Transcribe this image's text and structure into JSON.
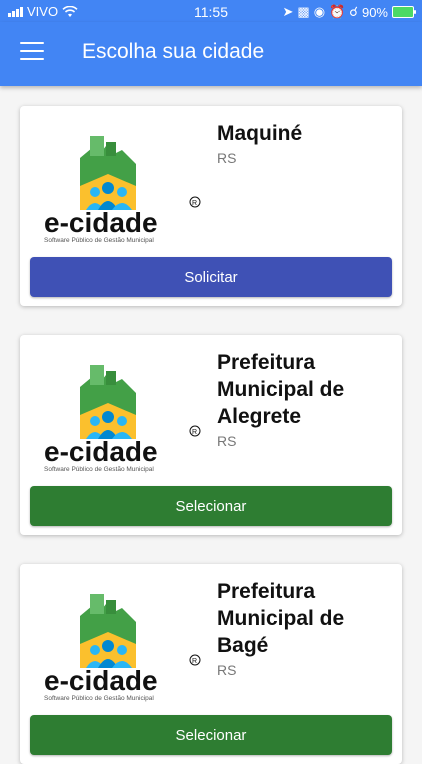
{
  "status_bar": {
    "carrier": "VIVO",
    "time": "11:55",
    "battery": "90%"
  },
  "header": {
    "title": "Escolha sua cidade"
  },
  "logo": {
    "brand": "e-cidade",
    "tagline": "Software Público de Gestão Municipal"
  },
  "cities": [
    {
      "name": "Maquiné",
      "state": "RS",
      "button": "Solicitar"
    },
    {
      "name": "Prefeitura Municipal de Alegrete",
      "state": "RS",
      "button": "Selecionar"
    },
    {
      "name": "Prefeitura Municipal de Bagé",
      "state": "RS",
      "button": "Selecionar"
    }
  ],
  "colors": {
    "primary": "#4285f4",
    "solicitar": "#3f51b5",
    "selecionar": "#2e7d32"
  }
}
